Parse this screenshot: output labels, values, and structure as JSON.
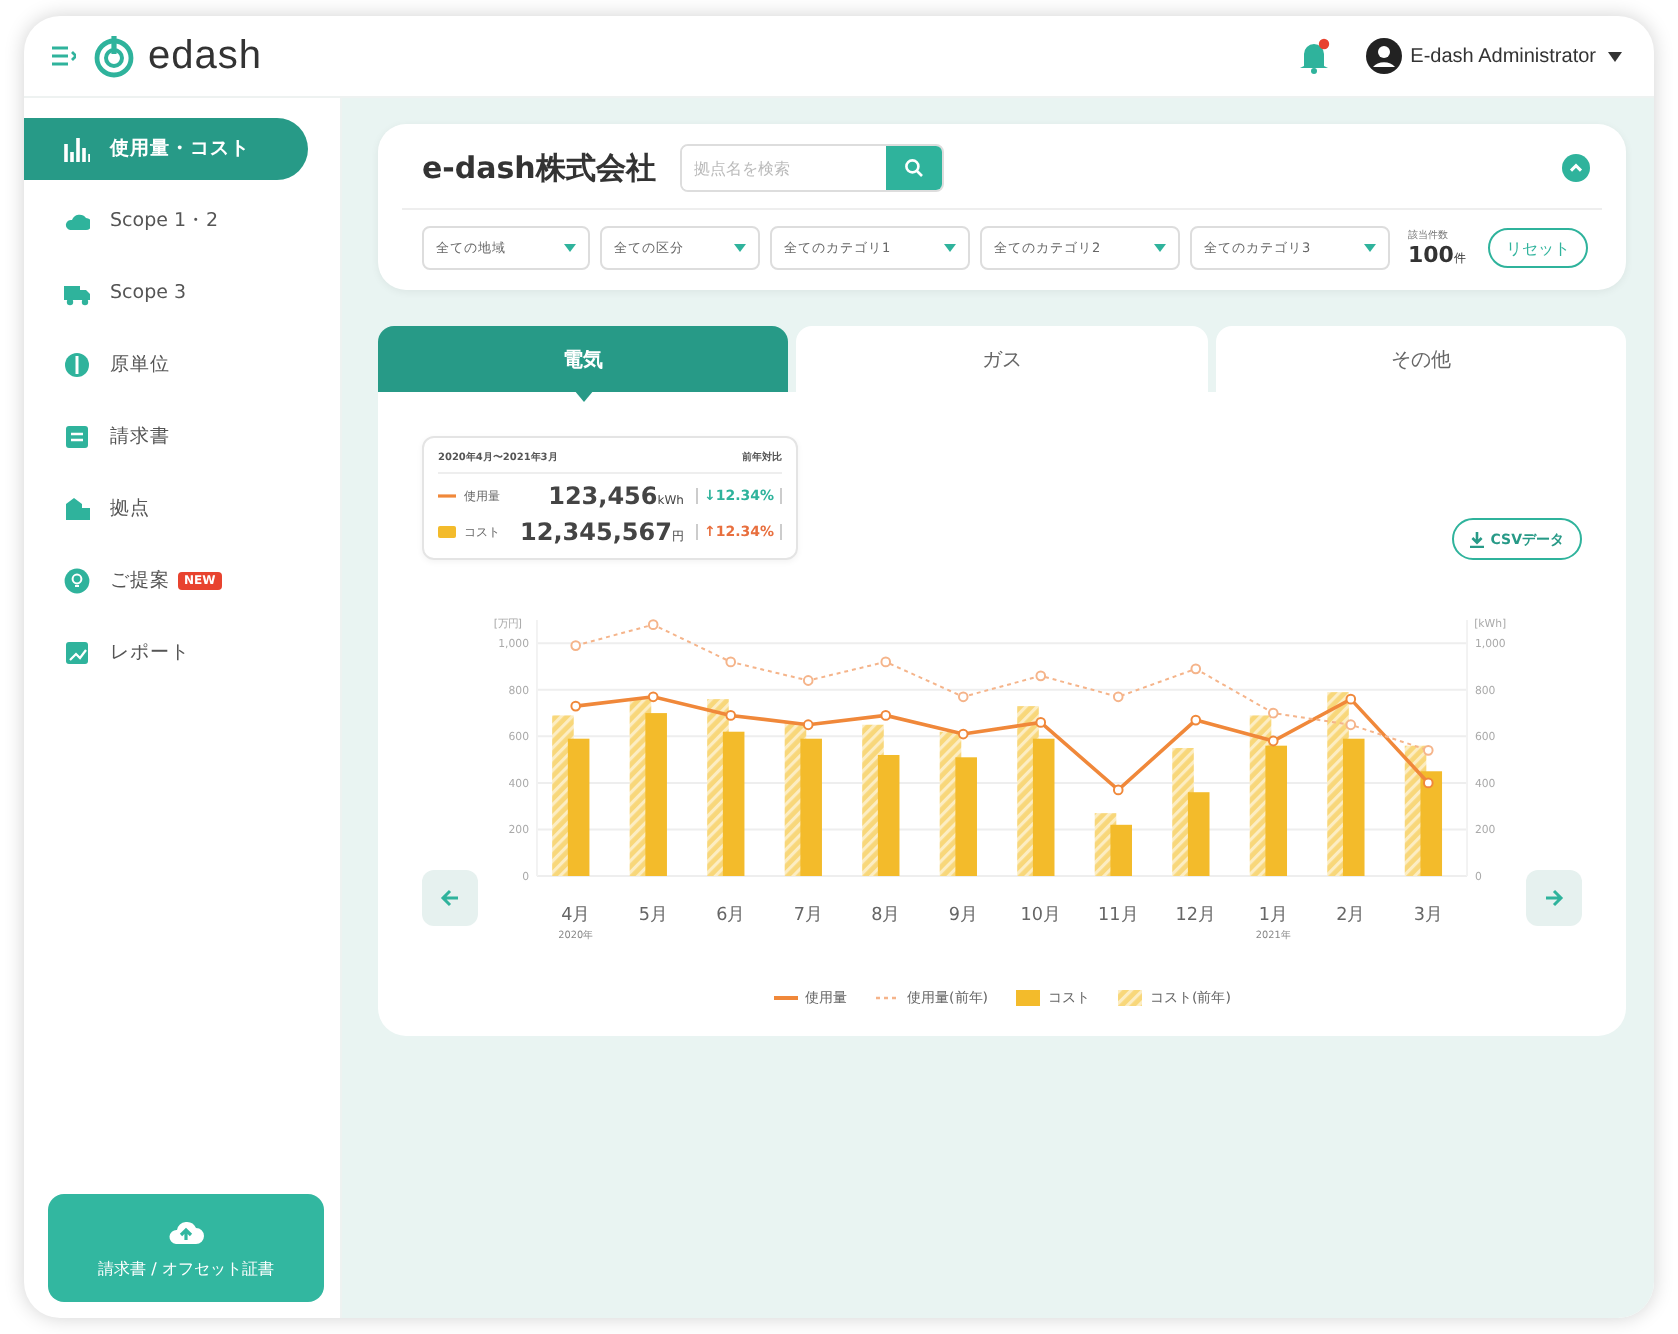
{
  "header": {
    "brand": "edash",
    "user": "E-dash Administrator",
    "notification": true
  },
  "sidebar": {
    "items": [
      {
        "label": "使用量・コスト",
        "selected": true
      },
      {
        "label": "Scope 1・2",
        "selected": false
      },
      {
        "label": "Scope 3",
        "selected": false
      },
      {
        "label": "原単位",
        "selected": false
      },
      {
        "label": "請求書",
        "selected": false
      },
      {
        "label": "拠点",
        "selected": false
      },
      {
        "label": "ご提案",
        "badge": "NEW",
        "selected": false
      },
      {
        "label": "レポート",
        "selected": false
      }
    ],
    "upload_button": "請求書 / オフセット証書"
  },
  "filters": {
    "company": "e-dash株式会社",
    "search": {
      "placeholder": "拠点名を検索"
    },
    "dropdowns": [
      "全ての地域",
      "全ての区分",
      "全てのカテゴリ1",
      "全てのカテゴリ2",
      "全てのカテゴリ3"
    ],
    "count_label": "該当件数",
    "count": "100",
    "count_unit": "件",
    "reset": "リセット"
  },
  "tabs": [
    {
      "label": "電気",
      "selected": true
    },
    {
      "label": "ガス",
      "selected": false
    },
    {
      "label": "その他",
      "selected": false
    }
  ],
  "summary": {
    "period": "2020年4月〜2021年3月",
    "compare_label": "前年対比",
    "rows": [
      {
        "kind": "line",
        "label": "使用量",
        "value": "123,456",
        "unit": "kWh",
        "change": "↓12.34%",
        "color": "#2fb39c"
      },
      {
        "kind": "bar",
        "label": "コスト",
        "value": "12,345,567",
        "unit": "円",
        "change": "↑12.34%",
        "color": "#e86f3e"
      }
    ]
  },
  "csv_button": "CSVデータ",
  "chart_data": {
    "type": "bar",
    "ylabel": "[万円]",
    "y2label": "[kWh]",
    "categories": [
      "4月",
      "5月",
      "6月",
      "7月",
      "8月",
      "9月",
      "10月",
      "11月",
      "12月",
      "1月",
      "2月",
      "3月"
    ],
    "annotations": [
      "2020年",
      "2021年"
    ],
    "ylim": [
      0,
      1100
    ],
    "y2lim": [
      0,
      1100
    ],
    "stacked": false,
    "grid": true,
    "yticks": [
      0,
      200,
      400,
      600,
      800,
      {
        "value": 1000,
        "label": "1,000"
      }
    ],
    "y2ticks": [
      0,
      200,
      400,
      600,
      800,
      {
        "value": 1000,
        "label": "1,000"
      }
    ],
    "series": [
      {
        "name": "使用量",
        "type": "line",
        "marker": "circle",
        "color": "#f0883a",
        "values": [
          730,
          770,
          690,
          650,
          690,
          610,
          660,
          370,
          670,
          580,
          760,
          400
        ]
      },
      {
        "name": "使用量(前年)",
        "type": "line",
        "line_style": "dashed",
        "marker": "circle",
        "color": "#f5b48a",
        "values": [
          990,
          1080,
          920,
          840,
          920,
          770,
          860,
          770,
          890,
          700,
          650,
          540
        ]
      },
      {
        "name": "コスト",
        "color": "#f3bb2b",
        "values": [
          590,
          700,
          620,
          590,
          520,
          510,
          590,
          220,
          360,
          560,
          590,
          450
        ]
      },
      {
        "name": "コスト(前年)",
        "color": "#f8d77a",
        "values": [
          690,
          760,
          760,
          660,
          650,
          620,
          730,
          270,
          550,
          690,
          790,
          560
        ]
      }
    ]
  }
}
